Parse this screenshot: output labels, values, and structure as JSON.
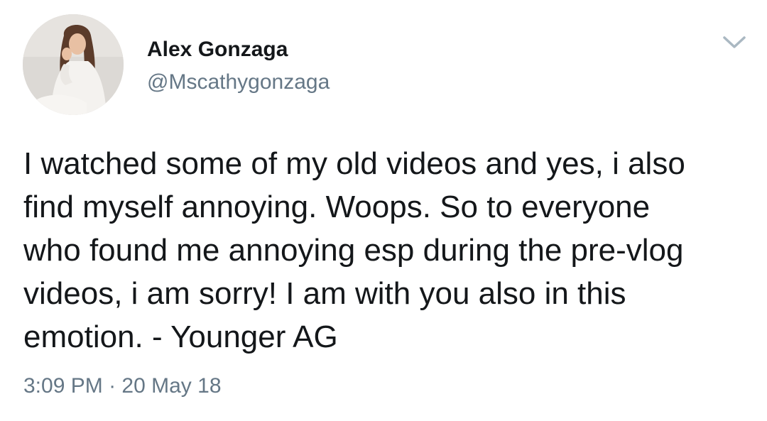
{
  "author": {
    "display_name": "Alex Gonzaga",
    "handle": "@Mscathygonzaga"
  },
  "icons": {
    "avatar": "profile-photo",
    "menu": "chevron-down-icon"
  },
  "tweet": {
    "lines": [
      "I watched some of my old videos and yes, i also",
      "find myself annoying. Woops. So to everyone",
      "who found me annoying esp during the pre-vlog",
      "videos, i am sorry! I am with you also in this",
      "emotion. - Younger AG"
    ],
    "time": "3:09 PM",
    "separator": "·",
    "date": "20 May 18"
  },
  "colors": {
    "text": "#14171a",
    "secondary": "#657786",
    "chevron": "#aab8c2"
  }
}
